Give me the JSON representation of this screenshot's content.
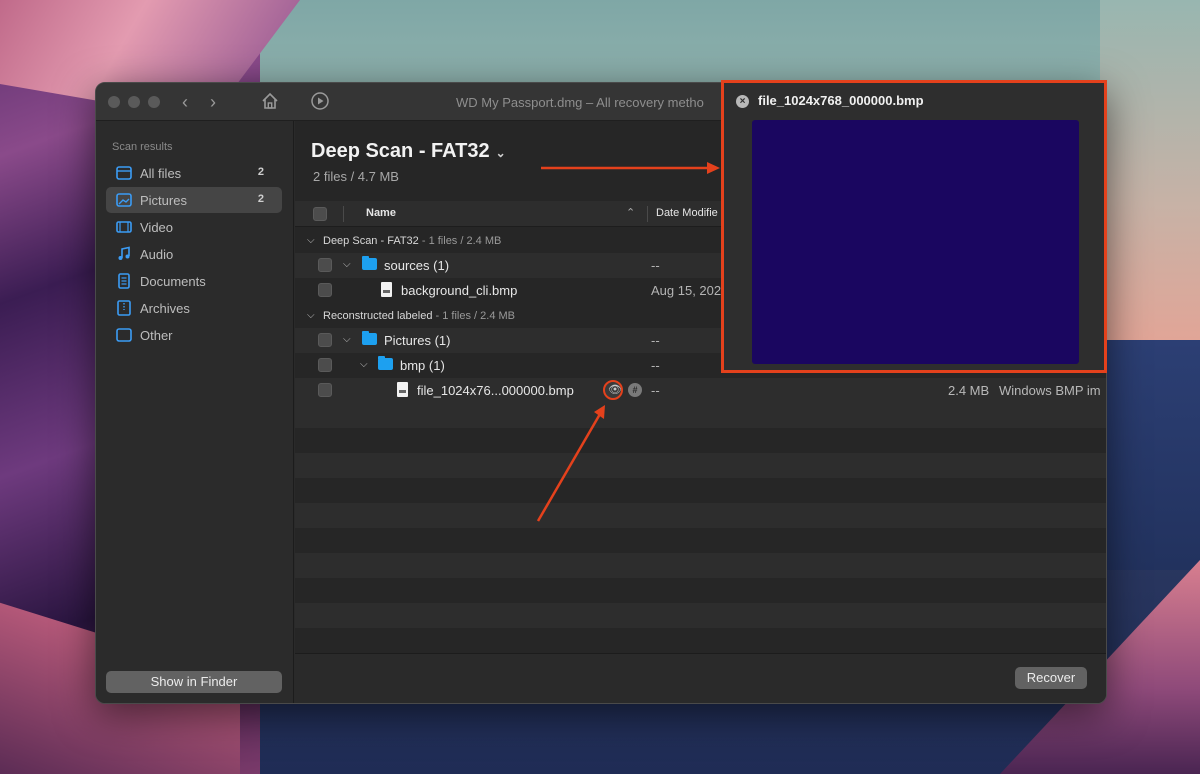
{
  "window": {
    "title": "WD My Passport.dmg – All recovery metho"
  },
  "toolbar": {
    "back_icon": "chevron-left-icon",
    "forward_icon": "chevron-right-icon",
    "home_icon": "home-icon",
    "play_icon": "play-circle-icon"
  },
  "sidebar": {
    "heading": "Scan results",
    "items": [
      {
        "label": "All files",
        "count": "2",
        "icon": "all-files-icon"
      },
      {
        "label": "Pictures",
        "count": "2",
        "icon": "pictures-icon"
      },
      {
        "label": "Video",
        "count": "",
        "icon": "video-icon"
      },
      {
        "label": "Audio",
        "count": "",
        "icon": "audio-icon"
      },
      {
        "label": "Documents",
        "count": "",
        "icon": "documents-icon"
      },
      {
        "label": "Archives",
        "count": "",
        "icon": "archives-icon"
      },
      {
        "label": "Other",
        "count": "",
        "icon": "other-icon"
      }
    ],
    "show_in_finder": "Show in Finder"
  },
  "main": {
    "title": "Deep Scan - FAT32",
    "subtitle": "2 files / 4.7 MB",
    "columns": {
      "name": "Name",
      "date": "Date Modifie"
    },
    "groups": [
      {
        "title": "Deep Scan - FAT32",
        "meta": " - 1 files / 2.4 MB",
        "rows": [
          {
            "name": "sources (1)",
            "date": "--"
          },
          {
            "name": "background_cli.bmp",
            "date": "Aug 15, 202"
          }
        ]
      },
      {
        "title": "Reconstructed labeled",
        "meta": " - 1 files / 2.4 MB",
        "rows": [
          {
            "name": "Pictures (1)",
            "date": "--"
          },
          {
            "name": "bmp (1)",
            "date": "--"
          },
          {
            "name": "file_1024x76...000000.bmp",
            "date": "--",
            "size": "2.4 MB",
            "kind": "Windows BMP im"
          }
        ]
      }
    ],
    "recover": "Recover"
  },
  "preview": {
    "title": "file_1024x768_000000.bmp",
    "image_color": "#1a0660"
  },
  "colors": {
    "accent_annotation": "#e4411c",
    "folder": "#1da0f0"
  }
}
